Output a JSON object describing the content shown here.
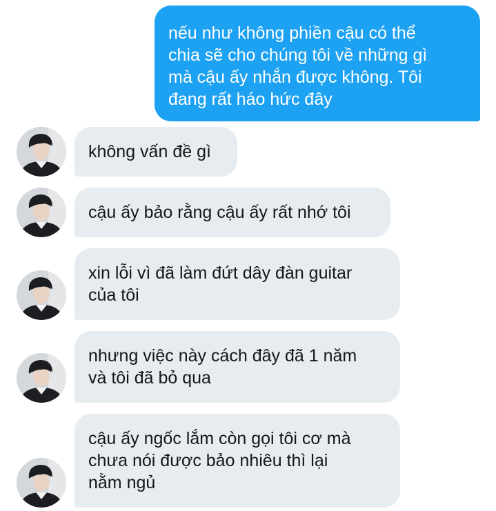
{
  "conversation": {
    "outgoing": [
      {
        "text": "nếu như không phiền cậu có thể\nchia sẽ cho chúng tôi về những gì\nmà cậu ấy nhắn được không. Tôi\nđang rất háo hức đây"
      }
    ],
    "incoming": [
      {
        "text": "không vấn đề gì"
      },
      {
        "text": "cậu ấy bảo rằng cậu ấy rất nhớ tôi"
      },
      {
        "text": "xin lỗi vì đã làm đứt dây đàn guitar\ncủa tôi"
      },
      {
        "text": "nhưng việc này cách đây đã 1 năm\nvà tôi đã bỏ qua"
      },
      {
        "text": "cậu ấy ngốc lắm còn gọi tôi cơ mà\nchưa nói được bảo nhiêu thì lại\nnằm ngủ"
      }
    ]
  },
  "colors": {
    "outgoing_bubble": "#1da1f2",
    "incoming_bubble": "#e6ecf0",
    "incoming_text": "#14171a",
    "outgoing_text": "#ffffff"
  },
  "icons": {
    "avatar": "user-avatar-photo"
  }
}
